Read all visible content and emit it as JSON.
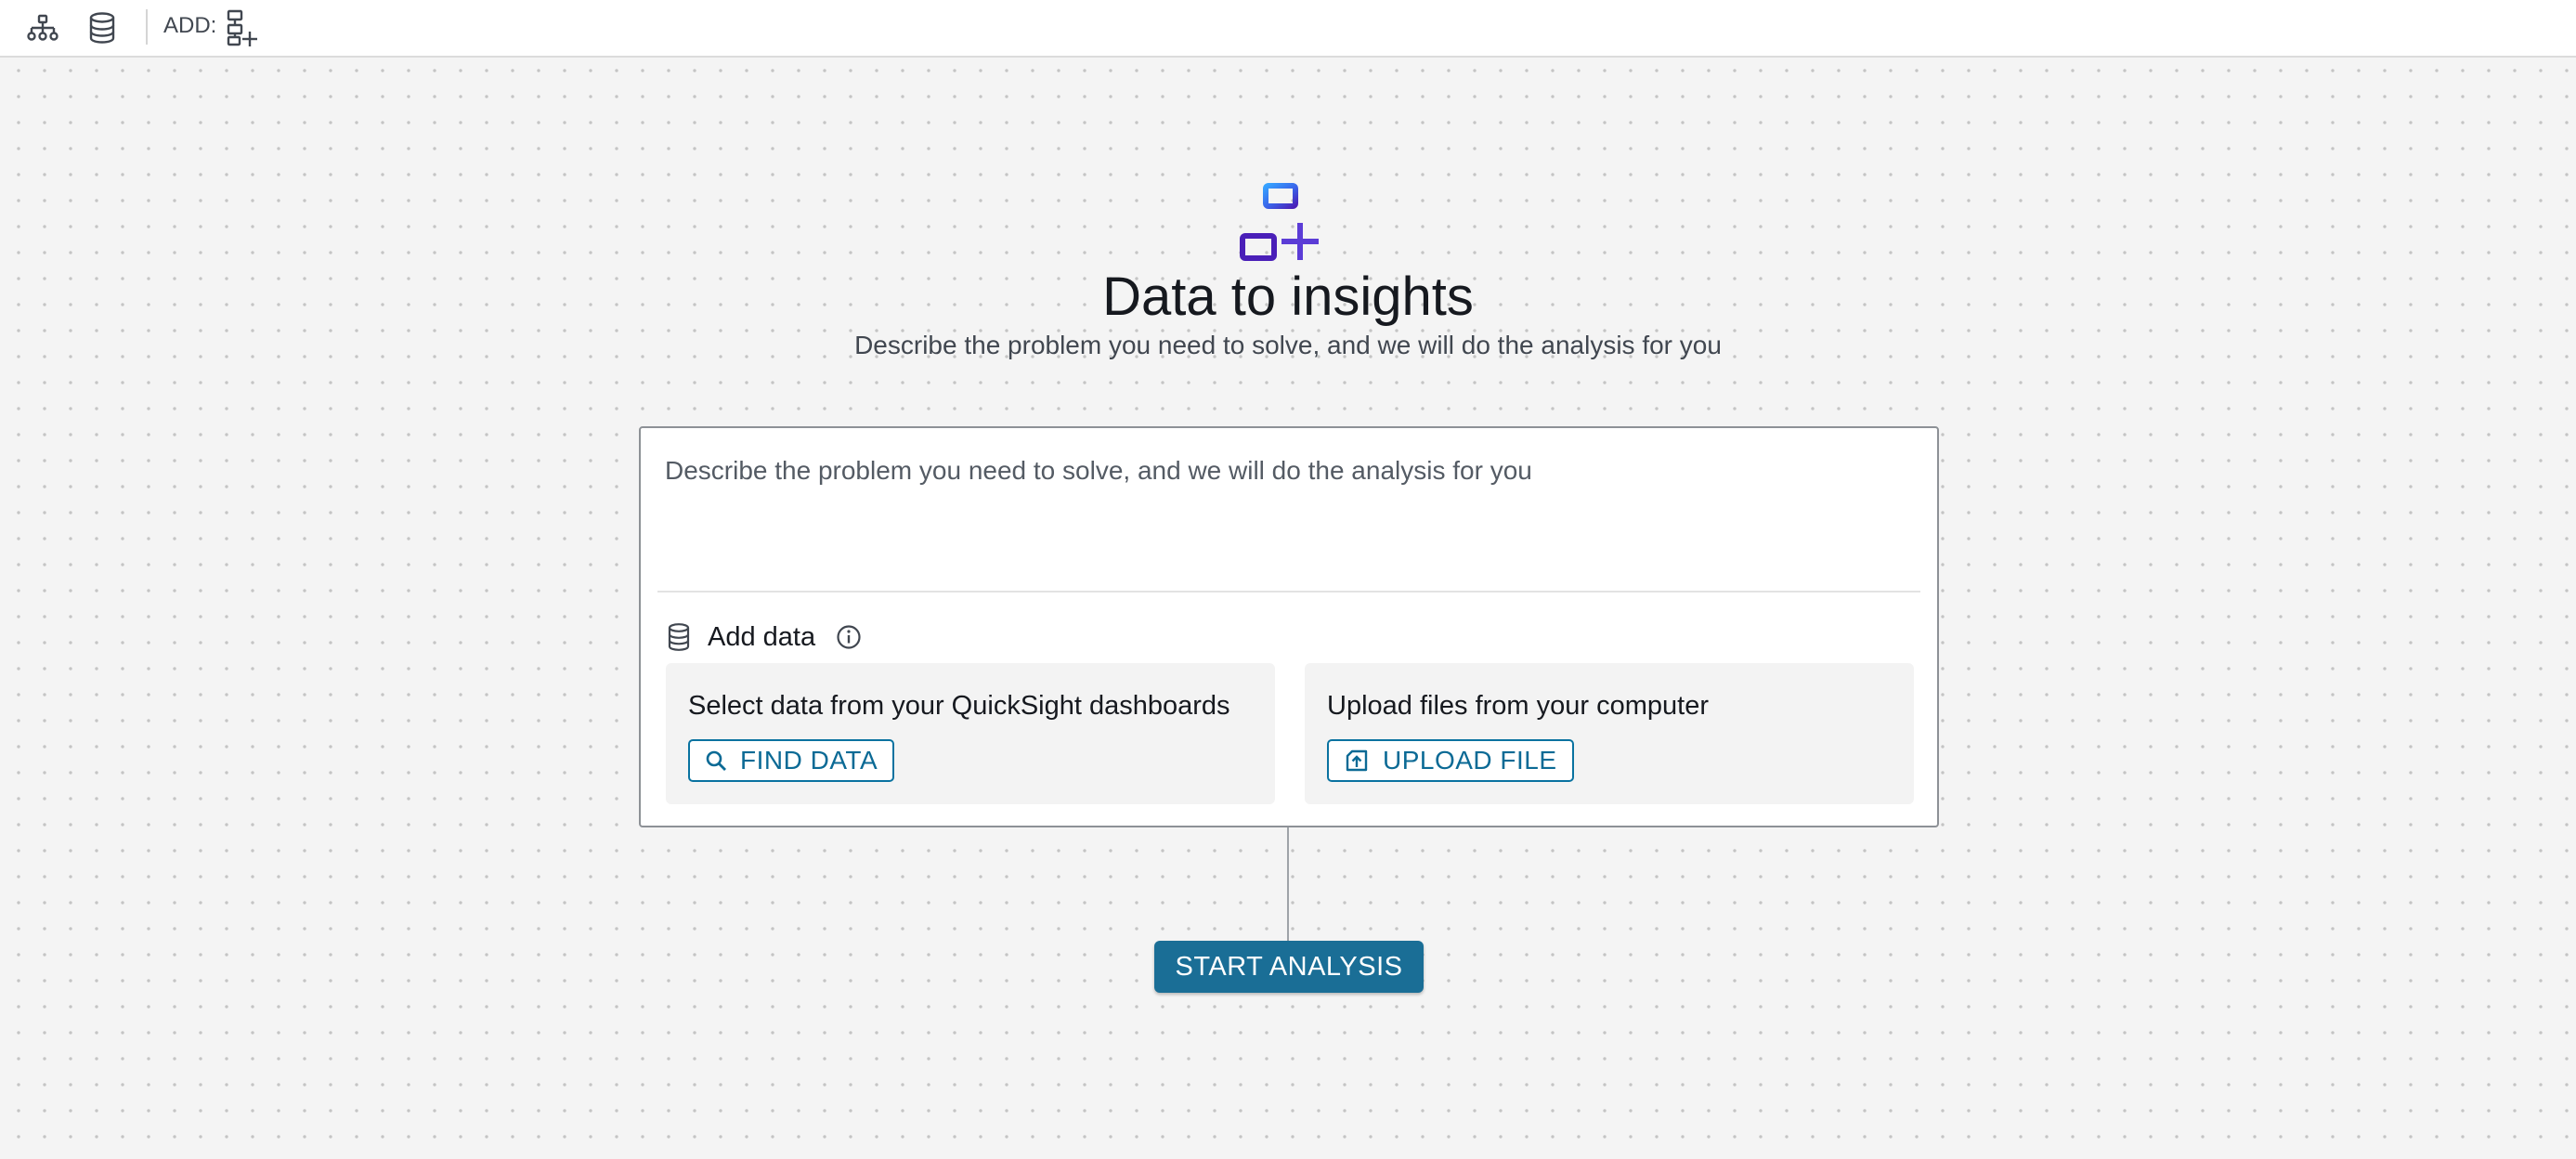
{
  "toolbar": {
    "add_label": "ADD:",
    "icons": [
      "hierarchy-icon",
      "database-icon",
      "add-analysis-icon"
    ]
  },
  "hero": {
    "title": "Data to insights",
    "subtitle": "Describe the problem you need to solve, and we will do the analysis for you",
    "icon": "analysis-flow-add-icon"
  },
  "prompt": {
    "placeholder": "Describe the problem you need to solve, and we will do the analysis for you",
    "value": ""
  },
  "add_data": {
    "label": "Add data",
    "icons": [
      "database-icon",
      "info-icon"
    ],
    "options": [
      {
        "title": "Select data from your QuickSight dashboards",
        "button": "FIND DATA",
        "icon": "search-icon"
      },
      {
        "title": "Upload files from your computer",
        "button": "UPLOAD FILE",
        "icon": "upload-icon"
      }
    ]
  },
  "actions": {
    "start_label": "START ANALYSIS"
  },
  "colors": {
    "accent": "#0972a0",
    "primary_button": "#1a6e96",
    "hero_icon_blue": "#2f7df6",
    "hero_icon_purple": "#5b3cd6"
  }
}
